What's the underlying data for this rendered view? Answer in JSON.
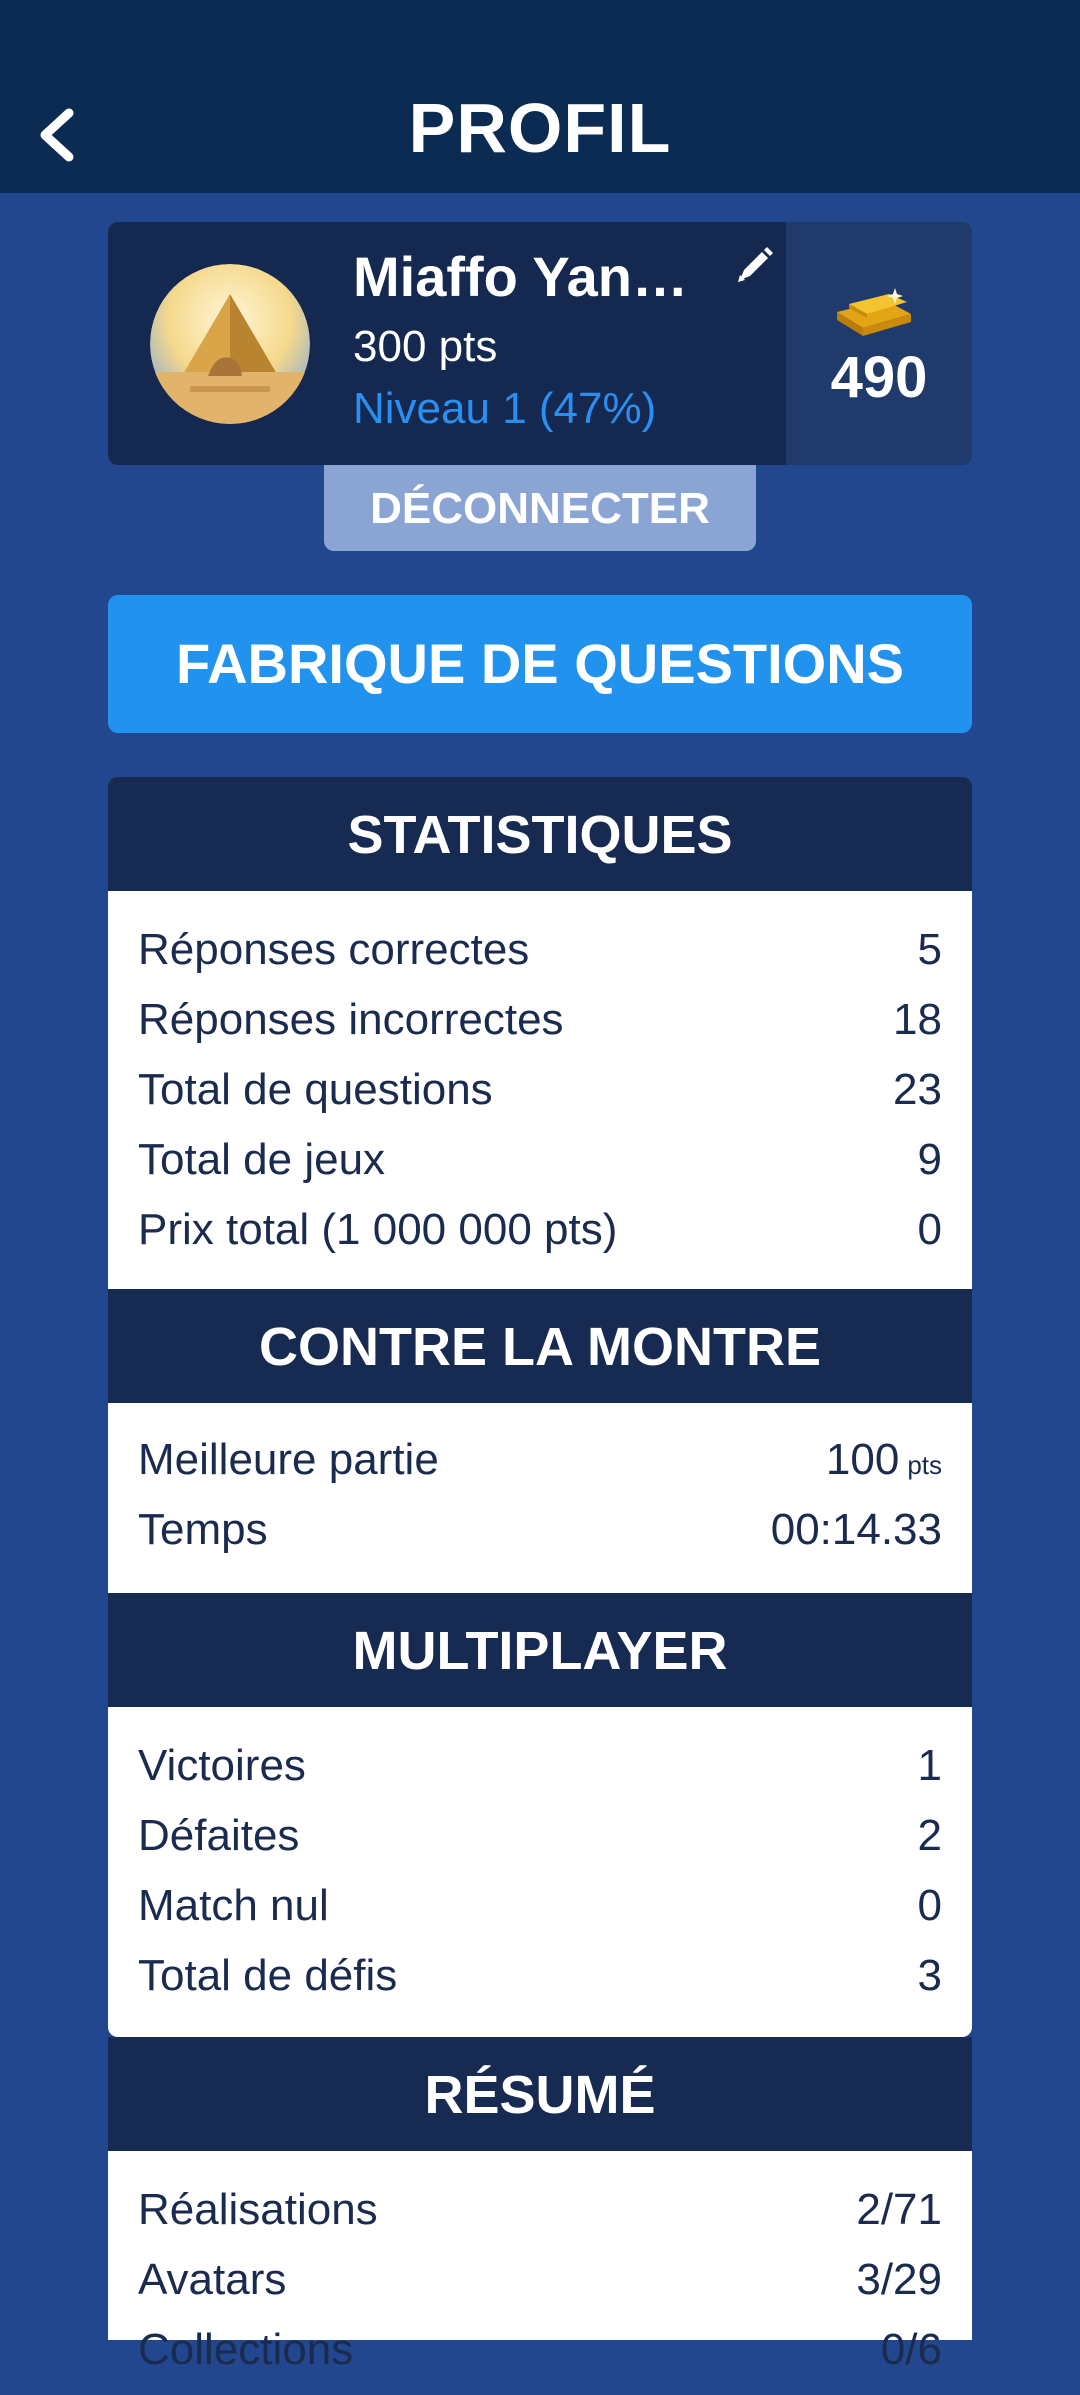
{
  "header": {
    "title": "PROFIL",
    "back_icon": "chevron-left-icon"
  },
  "profile": {
    "name": "Miaffo Yan…",
    "points": "300 pts",
    "level": "Niveau 1 (47%)",
    "gold": "490",
    "edit_icon": "pencil-icon",
    "gold_icon": "gold-bars-icon"
  },
  "logout_label": "DÉCONNECTER",
  "factory_label": "FABRIQUE DE QUESTIONS",
  "statistiques": {
    "title": "STATISTIQUES",
    "rows": [
      {
        "label": "Réponses correctes",
        "value": "5"
      },
      {
        "label": "Réponses incorrectes",
        "value": "18"
      },
      {
        "label": "Total de questions",
        "value": "23"
      },
      {
        "label": "Total de jeux",
        "value": "9"
      },
      {
        "label": "Prix total (1 000 000 pts)",
        "value": "0"
      }
    ]
  },
  "contre_la_montre": {
    "title": "CONTRE LA MONTRE",
    "best_label": "Meilleure partie",
    "best_value": "100",
    "best_unit": "pts",
    "time_label": "Temps",
    "time_value": "00:14.33"
  },
  "multiplayer": {
    "title": "MULTIPLAYER",
    "rows": [
      {
        "label": "Victoires",
        "value": "1"
      },
      {
        "label": "Défaites",
        "value": "2"
      },
      {
        "label": "Match nul",
        "value": "0"
      },
      {
        "label": "Total de défis",
        "value": "3"
      }
    ]
  },
  "resume": {
    "title": "RÉSUMÉ",
    "rows": [
      {
        "label": "Réalisations",
        "value": "2/71"
      },
      {
        "label": "Avatars",
        "value": "3/29"
      },
      {
        "label": "Collections",
        "value": "0/6"
      }
    ]
  },
  "colors": {
    "background": "#22478f",
    "topbar": "#0c2b52",
    "section_header": "#172a52",
    "accent_blue": "#2193ee",
    "level_text": "#2a8ff0",
    "logout_button": "#8aa5d4"
  }
}
